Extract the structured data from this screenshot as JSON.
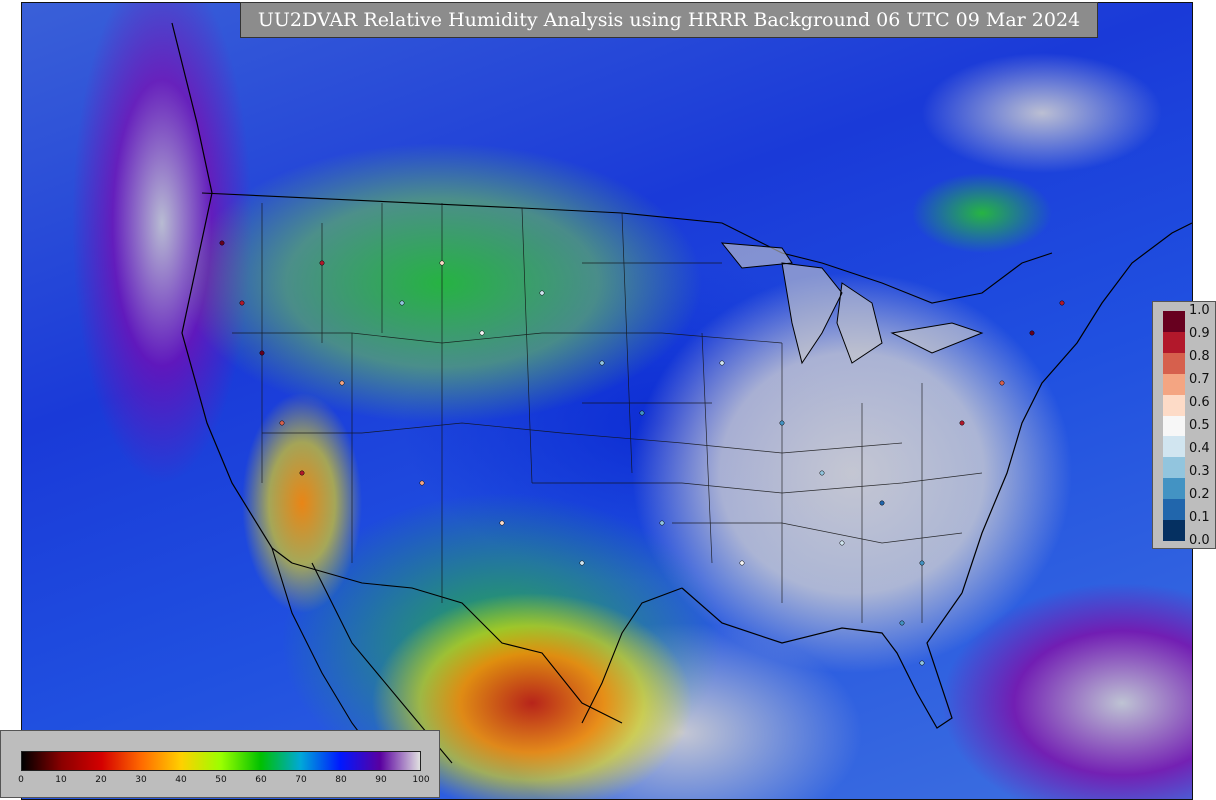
{
  "title": "UU2DVAR Relative Humidity Analysis using HRRR Background 06 UTC 09 Mar 2024",
  "obs_legend": {
    "labels": [
      "1.0",
      "0.9",
      "0.8",
      "0.7",
      "0.6",
      "0.5",
      "0.4",
      "0.3",
      "0.2",
      "0.1",
      "0.0"
    ],
    "colors": [
      "#67001f",
      "#b2182b",
      "#d6604d",
      "#f4a582",
      "#fddbc7",
      "#f7f7f7",
      "#d1e5f0",
      "#92c5de",
      "#4393c3",
      "#2166ac",
      "#053061"
    ]
  },
  "rh_legend": {
    "ticks": [
      "0",
      "10",
      "20",
      "30",
      "40",
      "50",
      "60",
      "70",
      "80",
      "90",
      "100"
    ],
    "color_stops": [
      "#000000",
      "#8b0000",
      "#d40000",
      "#ff6a00",
      "#ffd000",
      "#9aff00",
      "#00c000",
      "#00a8d8",
      "#0018ff",
      "#5a00a0",
      "#e0e0e0"
    ]
  },
  "colors": {
    "title_bg": "#8c8c8c",
    "legend_bg": "#bdbdbd"
  }
}
